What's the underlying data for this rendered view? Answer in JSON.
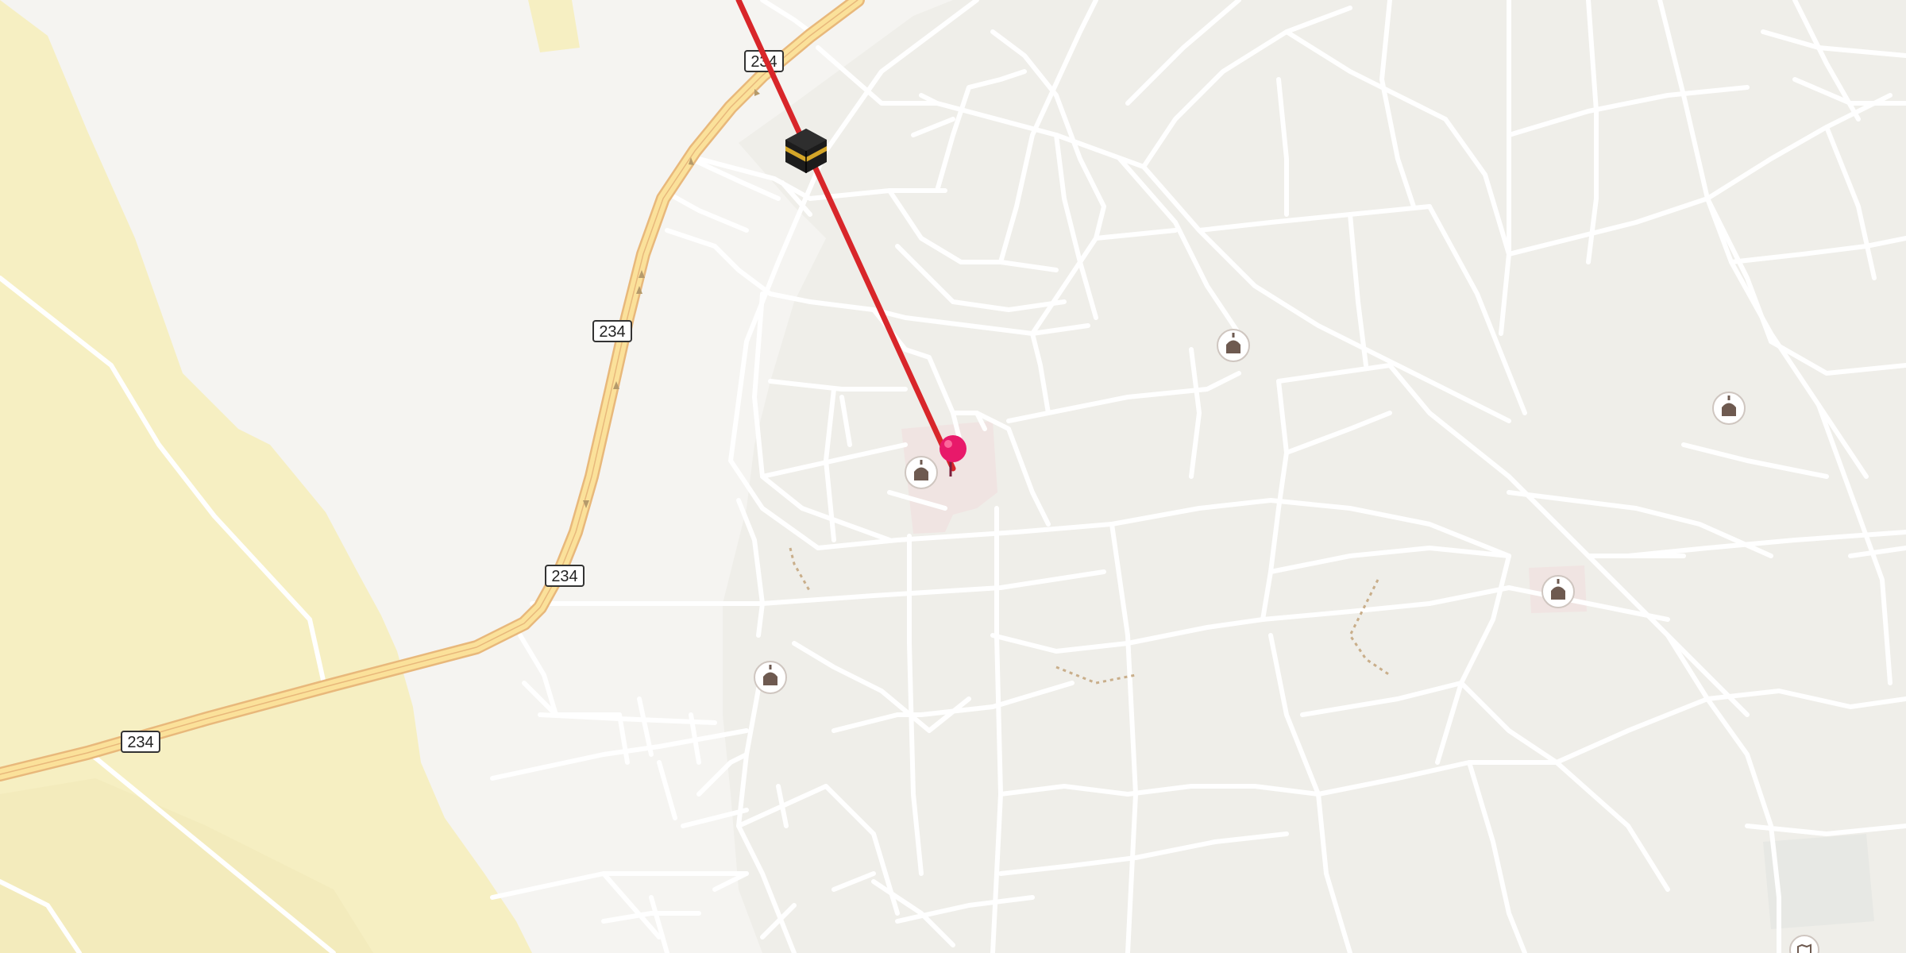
{
  "map": {
    "route_shields": [
      {
        "id": "shield-1",
        "label": "234"
      },
      {
        "id": "shield-2",
        "label": "234"
      },
      {
        "id": "shield-3",
        "label": "234"
      },
      {
        "id": "shield-4",
        "label": "234"
      }
    ],
    "markers": {
      "kaaba_icon": "kaaba-icon",
      "location_pin": "location-pin-icon",
      "mosque_icons": [
        "mosque-icon",
        "mosque-icon",
        "mosque-icon",
        "mosque-icon",
        "mosque-icon"
      ],
      "corner_icon": "map-corner-icon"
    },
    "colors": {
      "background": "#f5f4f1",
      "urban_fill": "#efeee9",
      "desert_fill": "#f6efc2",
      "highway_fill": "#fbe19a",
      "highway_edge": "#e8b87b",
      "street": "#ffffff",
      "qibla_line": "#d8262a",
      "pin": "#e8196a",
      "mosque_badge": "#6e5a50",
      "amenity_fill": "#f0e4e2"
    }
  }
}
